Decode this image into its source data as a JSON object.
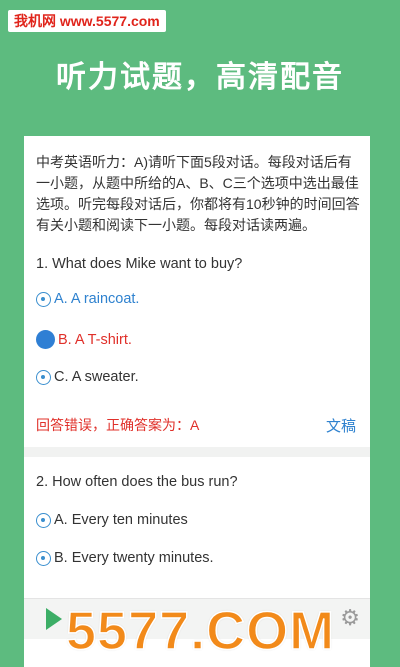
{
  "watermark_top": "我机网 www.5577.com",
  "hero_title": "听力试题，高清配音",
  "instructions": "中考英语听力：A)请听下面5段对话。每段对话后有一小题，从题中所给的A、B、C三个选项中选出最佳选项。听完每段对话后，你都将有10秒钟的时间回答有关小题和阅读下一小题。每段对话读两遍。",
  "question1": {
    "text": "1. What does Mike want to buy?",
    "options": [
      "A. A raincoat.",
      "B. A T-shirt.",
      "C. A sweater."
    ],
    "selected_index": 1,
    "feedback": "回答错误，正确答案为：A",
    "doc_link": "文稿"
  },
  "question2": {
    "text": "2. How often does the bus run?",
    "options": [
      "A. Every ten minutes",
      "B. Every twenty minutes."
    ]
  },
  "watermark_bottom": "5577.COM",
  "colors": {
    "background": "#5dbb7f",
    "accent_blue": "#2f82cf",
    "error_red": "#e0302a",
    "watermark_orange": "#f28a1a"
  }
}
